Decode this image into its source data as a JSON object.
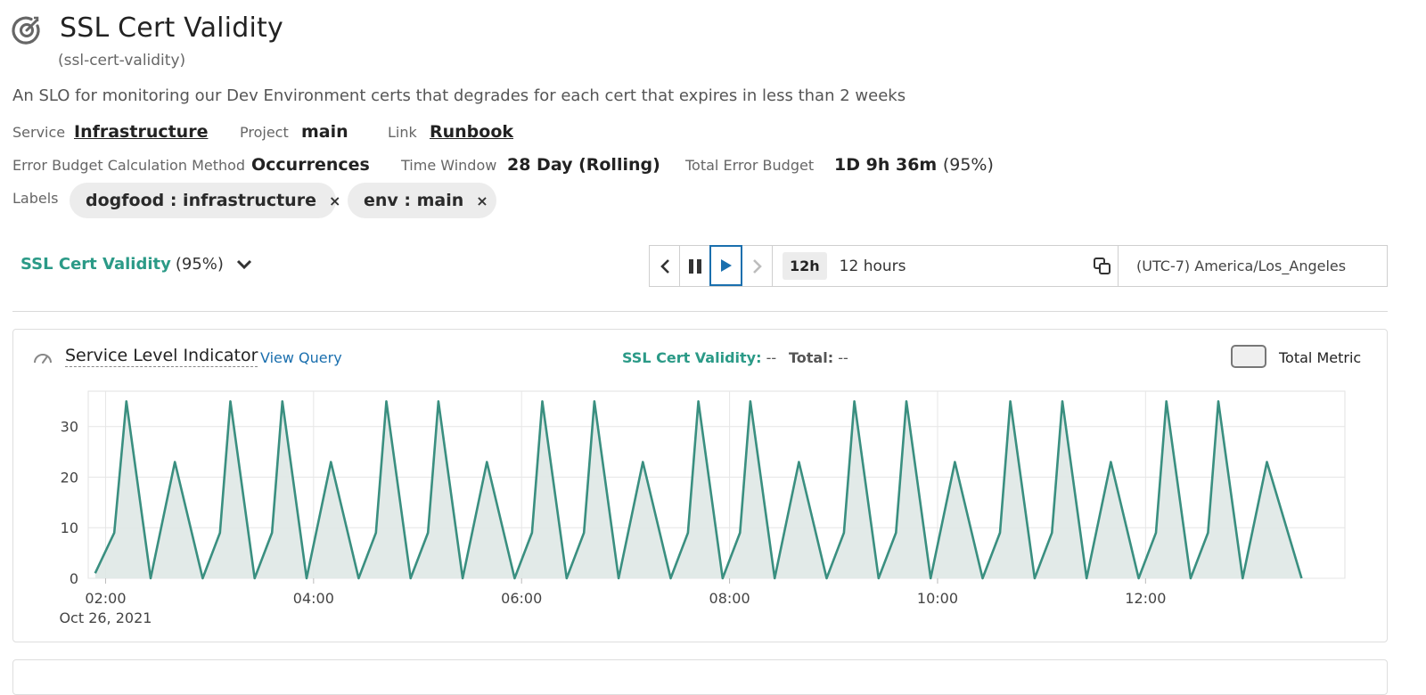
{
  "header": {
    "title": "SSL Cert Validity",
    "slug": "(ssl-cert-validity)",
    "description": "An SLO for monitoring our Dev Environment certs that degrades for each cert that expires in less than 2 weeks"
  },
  "meta": {
    "service_label": "Service",
    "service_value": "Infrastructure",
    "project_label": "Project",
    "project_value": "main",
    "link_label": "Link",
    "link_value": "Runbook",
    "method_label": "Error Budget Calculation Method",
    "method_value": "Occurrences",
    "window_label": "Time Window",
    "window_value": "28 Day (Rolling)",
    "budget_label": "Total Error Budget",
    "budget_value": "1D 9h 36m",
    "budget_pct": "(95%)",
    "labels_label": "Labels"
  },
  "labels": [
    {
      "text": "dogfood : infrastructure",
      "remove": "×"
    },
    {
      "text": "env : main",
      "remove": "×"
    }
  ],
  "slo_selector": {
    "name": "SSL Cert Validity",
    "pct": "(95%)"
  },
  "time_controls": {
    "range_badge": "12h",
    "range_label": "12 hours",
    "timezone": "(UTC-7) America/Los_Angeles"
  },
  "sli_panel": {
    "title": "Service Level Indicator",
    "view_query": "View Query",
    "legend_sli_key": "SSL Cert Validity:",
    "legend_sli_value": "--",
    "legend_total_key": "Total:",
    "legend_total_value": "--",
    "total_metric_label": "Total Metric"
  },
  "colors": {
    "accent": "#2b9a87",
    "link": "#1a6fae",
    "series_line": "#3a8f80",
    "series_fill": "#dfe8e5"
  },
  "chart_data": {
    "type": "area",
    "x_axis": "time",
    "x_start": "Oct 26, 2021 01:54",
    "x_end": "Oct 26, 2021 13:30",
    "xlim": [
      "01:50",
      "13:55"
    ],
    "x_ticks": [
      "02:00",
      "04:00",
      "06:00",
      "08:00",
      "10:00",
      "12:00"
    ],
    "x_tick_date": "Oct 26, 2021",
    "y_ticks": [
      0,
      10,
      20,
      30
    ],
    "ylim": [
      0,
      37
    ],
    "grid": true,
    "series": [
      {
        "values": [
          [
            "01:54",
            1
          ],
          [
            "02:05",
            9
          ],
          [
            "02:12",
            35
          ],
          [
            "02:26",
            0
          ],
          [
            "02:40",
            23
          ],
          [
            "02:56",
            0
          ],
          [
            "03:06",
            9
          ],
          [
            "03:12",
            35
          ],
          [
            "03:26",
            0
          ],
          [
            "03:36",
            9
          ],
          [
            "03:42",
            35
          ],
          [
            "03:56",
            0
          ],
          [
            "04:10",
            23
          ],
          [
            "04:26",
            0
          ],
          [
            "04:36",
            9
          ],
          [
            "04:42",
            35
          ],
          [
            "04:56",
            0
          ],
          [
            "05:06",
            9
          ],
          [
            "05:12",
            35
          ],
          [
            "05:26",
            0
          ],
          [
            "05:40",
            23
          ],
          [
            "05:56",
            0
          ],
          [
            "06:06",
            9
          ],
          [
            "06:12",
            35
          ],
          [
            "06:26",
            0
          ],
          [
            "06:36",
            9
          ],
          [
            "06:42",
            35
          ],
          [
            "06:56",
            0
          ],
          [
            "07:10",
            23
          ],
          [
            "07:26",
            0
          ],
          [
            "07:36",
            9
          ],
          [
            "07:42",
            35
          ],
          [
            "07:56",
            0
          ],
          [
            "08:06",
            9
          ],
          [
            "08:12",
            35
          ],
          [
            "08:26",
            0
          ],
          [
            "08:40",
            23
          ],
          [
            "08:56",
            0
          ],
          [
            "09:06",
            9
          ],
          [
            "09:12",
            35
          ],
          [
            "09:26",
            0
          ],
          [
            "09:36",
            9
          ],
          [
            "09:42",
            35
          ],
          [
            "09:56",
            0
          ],
          [
            "10:10",
            23
          ],
          [
            "10:26",
            0
          ],
          [
            "10:36",
            9
          ],
          [
            "10:42",
            35
          ],
          [
            "10:56",
            0
          ],
          [
            "11:06",
            9
          ],
          [
            "11:12",
            35
          ],
          [
            "11:26",
            0
          ],
          [
            "11:40",
            23
          ],
          [
            "11:56",
            0
          ],
          [
            "12:06",
            9
          ],
          [
            "12:12",
            35
          ],
          [
            "12:26",
            0
          ],
          [
            "12:36",
            9
          ],
          [
            "12:42",
            35
          ],
          [
            "12:56",
            0
          ],
          [
            "13:10",
            23
          ],
          [
            "13:30",
            0
          ]
        ]
      }
    ]
  }
}
